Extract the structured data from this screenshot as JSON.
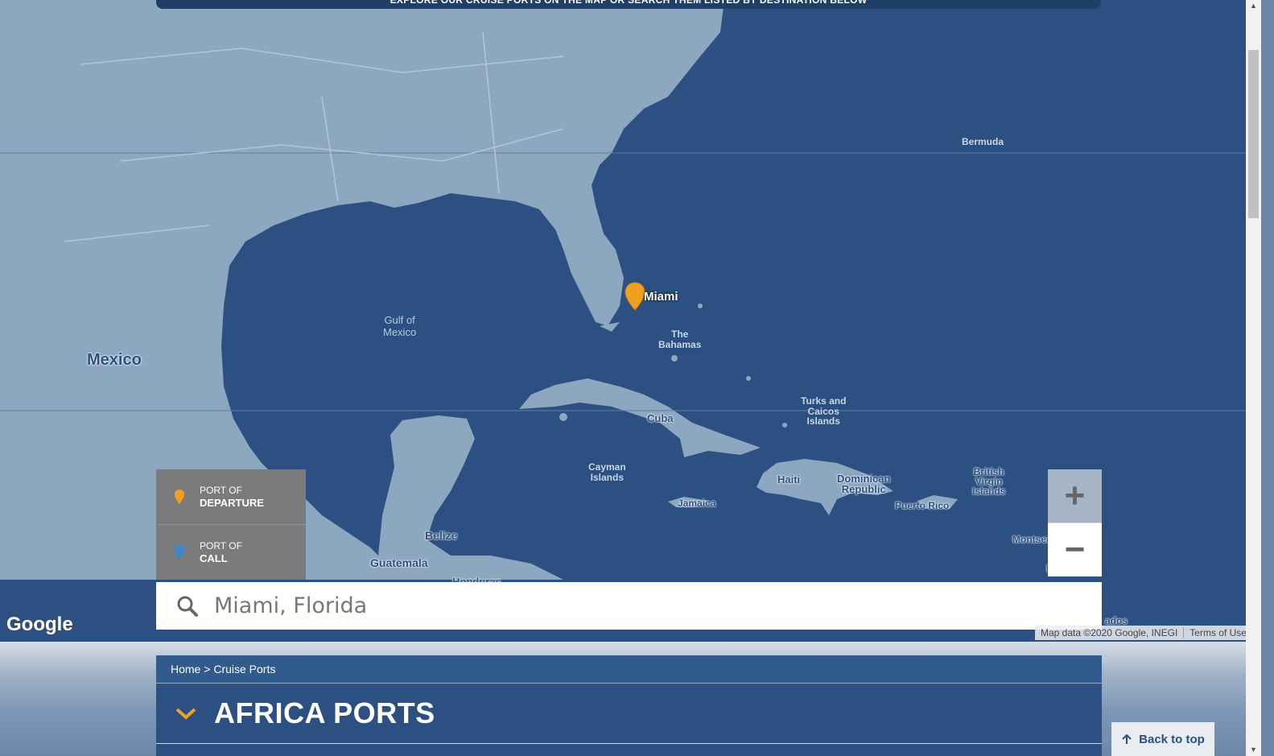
{
  "banner": "EXPLORE OUR CRUISE PORTS ON THE MAP OR SEARCH THEM LISTED BY DESTINATION BELOW",
  "map": {
    "labels": {
      "mexico": "Mexico",
      "gulf": "Gulf of\nMexico",
      "bermuda": "Bermuda",
      "bahamas": "The\nBahamas",
      "turks": "Turks and\nCaicos\nIslands",
      "cuba": "Cuba",
      "cayman": "Cayman\nIslands",
      "jamaica": "Jamaica",
      "haiti": "Haiti",
      "dominican": "Dominican\nRepublic",
      "puerto_rico": "Puerto Rico",
      "bvi": "British\nVirgin\nIslands",
      "montserrat": "Montserr",
      "dominica": "Do",
      "belize": "Belize",
      "guatemala": "Guatemala",
      "honduras": "Honduras",
      "barbados": "ados"
    },
    "pin_label": "Miami",
    "pin_color": "#f0a020",
    "call_color": "#3d86c8",
    "google": "Google",
    "attribution": "Map data ©2020 Google, INEGI",
    "terms": "Terms of Use"
  },
  "legend": {
    "departure_line1": "PORT OF",
    "departure_line2": "DEPARTURE",
    "call_line1": "PORT OF",
    "call_line2": "CALL"
  },
  "zoom": {
    "in": "+",
    "out": "−"
  },
  "search": {
    "value": "Miami, Florida",
    "placeholder": ""
  },
  "breadcrumb": {
    "home": "Home",
    "sep": " > ",
    "current": "Cruise Ports"
  },
  "section": {
    "title": "AFRICA PORTS"
  },
  "back_to_top": "Back to top"
}
